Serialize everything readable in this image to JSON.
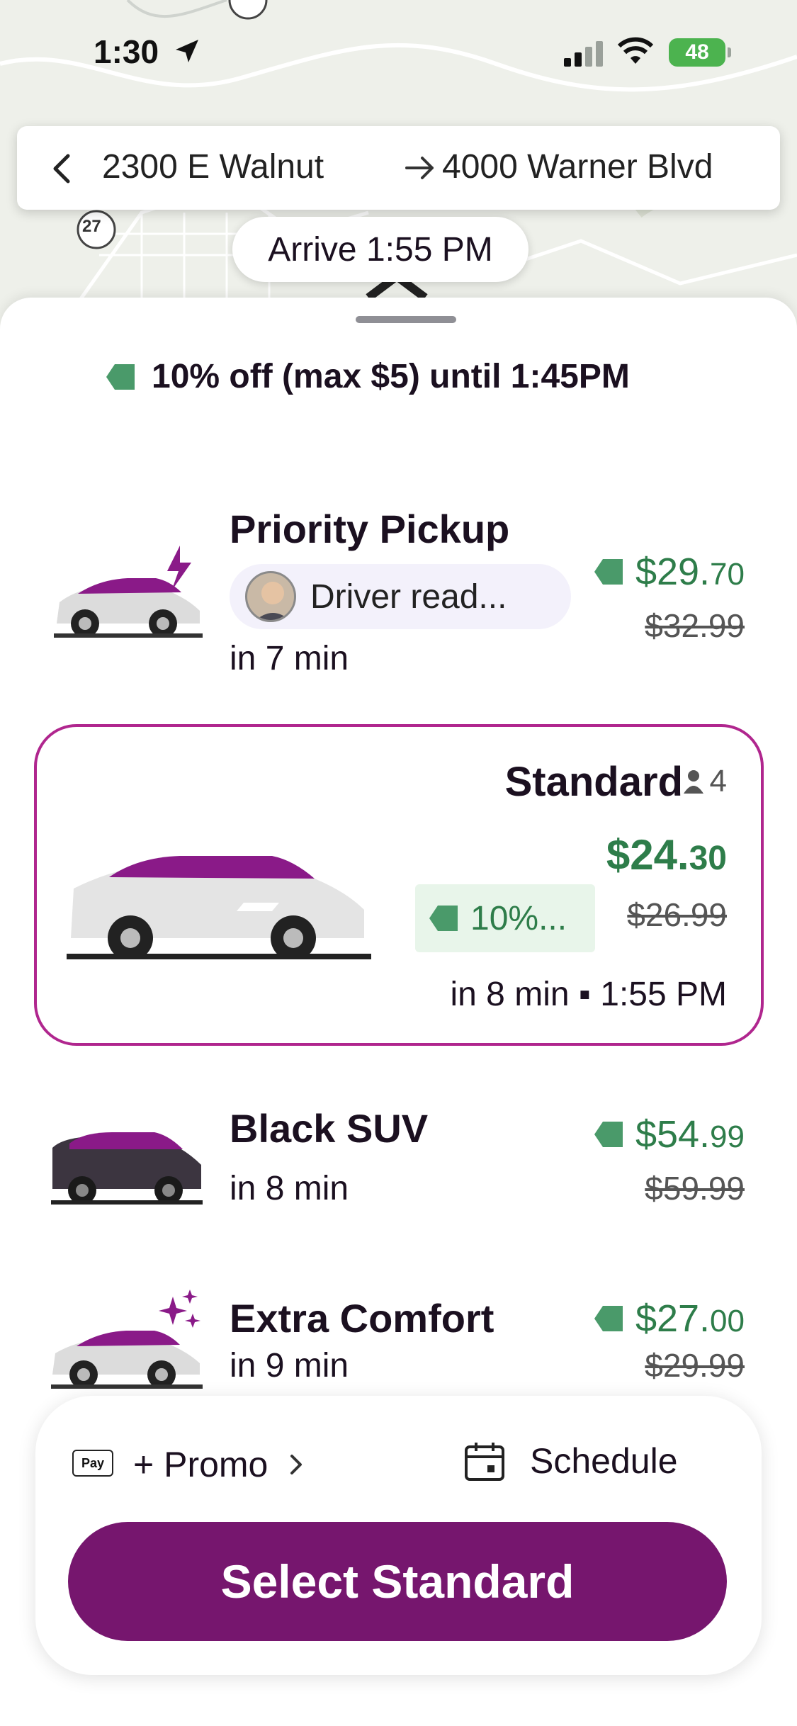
{
  "status_bar": {
    "time": "1:30",
    "battery": "48"
  },
  "route": {
    "from": "2300 E Walnut",
    "to": "4000 Warner Blvd"
  },
  "map": {
    "arrive": "Arrive 1:55 PM",
    "route_badge": "27"
  },
  "promo_banner": "10% off (max $5) until 1:45PM",
  "rides": [
    {
      "name": "Priority Pickup",
      "driver_label": "Driver read...",
      "eta": "in 7 min",
      "price_dollars": "$29.",
      "price_cents": "70",
      "old_price": "$32.99"
    },
    {
      "name": "Standard",
      "capacity": "4",
      "price_dollars": "$24.",
      "price_cents": "30",
      "discount": "10%...",
      "old_price": "$26.99",
      "eta": "in 8 min ▪ 1:55 PM"
    },
    {
      "name": "Black SUV",
      "eta": "in 8 min",
      "price_dollars": "$54.",
      "price_cents": "99",
      "old_price": "$59.99"
    },
    {
      "name": "Extra Comfort",
      "eta": "in 9 min",
      "price_dollars": "$27.",
      "price_cents": "00",
      "old_price": "$29.99"
    }
  ],
  "bottom": {
    "apple_pay": "Pay",
    "promo": "+ Promo",
    "schedule": "Schedule",
    "cta": "Select Standard"
  },
  "colors": {
    "brand": "#76166e",
    "selected_border": "#b0268e",
    "price_green": "#2e7d4a",
    "tag_green": "#4a9a6a"
  }
}
